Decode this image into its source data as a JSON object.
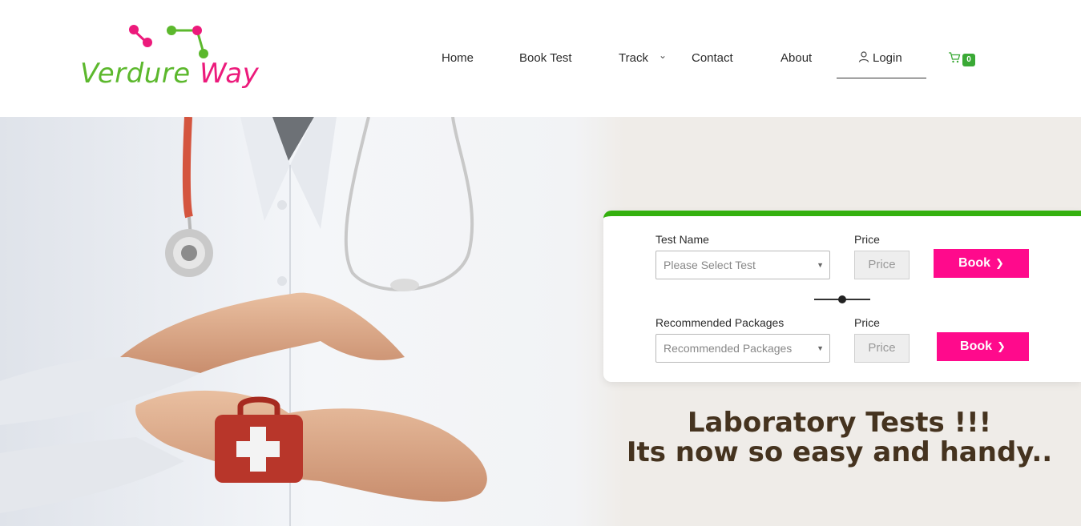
{
  "brand": {
    "name_part1": "Verdure",
    "name_part2": "Way",
    "green": "#5cb82d",
    "pink": "#ec1a7b"
  },
  "nav": {
    "home": "Home",
    "book_test": "Book Test",
    "track": "Track",
    "contact": "Contact",
    "about": "About",
    "login": "Login",
    "cart_count": "0"
  },
  "booking": {
    "test": {
      "label": "Test Name",
      "placeholder": "Please Select Test",
      "price_label": "Price",
      "price_placeholder": "Price",
      "button": "Book"
    },
    "package": {
      "label": "Recommended Packages",
      "placeholder": "Recommended Packages",
      "price_label": "Price",
      "price_placeholder": "Price",
      "button": "Book"
    }
  },
  "headline": {
    "line1": "Laboratory Tests !!!",
    "line2": "Its now so easy and handy.."
  },
  "colors": {
    "accent_pink": "#ff0a8c",
    "accent_green": "#34b00e",
    "headline": "#45331f"
  },
  "icons": [
    "molecule-logo-icon",
    "user-icon",
    "chevron-down-icon",
    "cart-icon",
    "caret-down-icon",
    "chevron-right-icon"
  ]
}
